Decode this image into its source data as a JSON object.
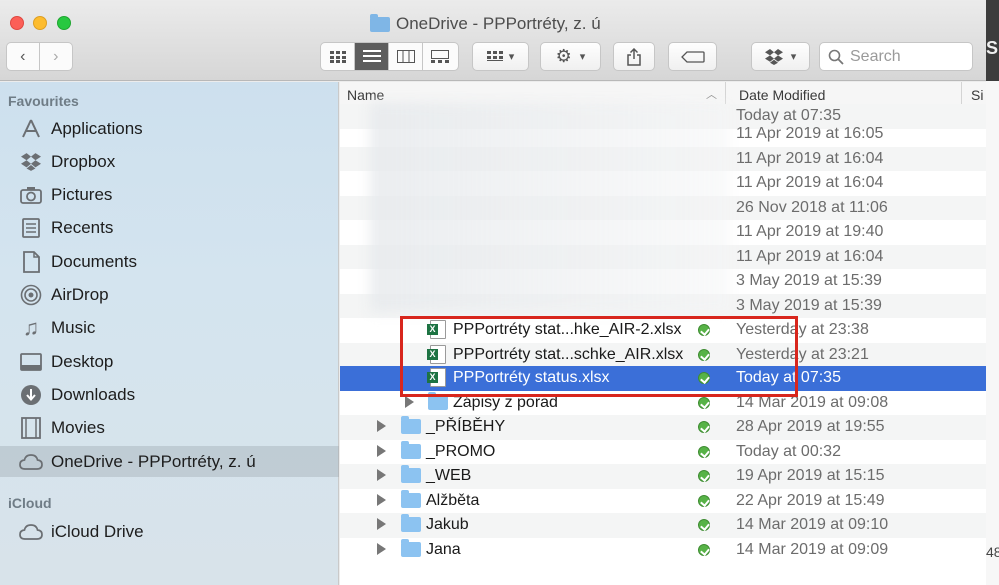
{
  "window": {
    "title": "OneDrive - PPPortréty, z. ú"
  },
  "toolbar": {
    "search_placeholder": "Search"
  },
  "sidebar": {
    "sections": [
      {
        "label": "Favourites",
        "items": [
          {
            "label": "Applications",
            "icon": "applications-icon"
          },
          {
            "label": "Dropbox",
            "icon": "dropbox-icon"
          },
          {
            "label": "Pictures",
            "icon": "camera-icon"
          },
          {
            "label": "Recents",
            "icon": "recents-icon"
          },
          {
            "label": "Documents",
            "icon": "document-icon"
          },
          {
            "label": "AirDrop",
            "icon": "airdrop-icon"
          },
          {
            "label": "Music",
            "icon": "music-note-icon"
          },
          {
            "label": "Desktop",
            "icon": "desktop-icon"
          },
          {
            "label": "Downloads",
            "icon": "download-icon"
          },
          {
            "label": "Movies",
            "icon": "film-icon"
          },
          {
            "label": "OneDrive - PPPortréty, z. ú",
            "icon": "cloud-icon",
            "selected": true
          }
        ]
      },
      {
        "label": "iCloud",
        "items": [
          {
            "label": "iCloud Drive",
            "icon": "cloud-icon"
          }
        ]
      }
    ]
  },
  "list": {
    "columns": {
      "name": "Name",
      "date": "Date Modified",
      "size": "Si"
    },
    "blurred_dates": [
      "Today at 07:35",
      "11 Apr 2019 at 16:05",
      "11 Apr 2019 at 16:04",
      "11 Apr 2019 at 16:04",
      "26 Nov 2018 at 11:06",
      "11 Apr 2019 at 19:40",
      "11 Apr 2019 at 16:04",
      "3 May 2019 at 15:39",
      "3 May 2019 at 15:39"
    ],
    "files": [
      {
        "name": "PPPortréty stat...hke_AIR-2.xlsx",
        "date": "Yesterday at 23:38",
        "kind": "xlsx"
      },
      {
        "name": "PPPortréty stat...schke_AIR.xlsx",
        "date": "Yesterday at 23:21",
        "kind": "xlsx"
      },
      {
        "name": "PPPortréty status.xlsx",
        "date": "Today at 07:35",
        "kind": "xlsx",
        "selected": true
      },
      {
        "name": "Zápisy z porad",
        "date": "14 Mar 2019 at 09:08",
        "kind": "folder",
        "level": 1
      },
      {
        "name": "_PŘÍBĚHY",
        "date": "28 Apr 2019 at 19:55",
        "kind": "folder"
      },
      {
        "name": "_PROMO",
        "date": "Today at 00:32",
        "kind": "folder"
      },
      {
        "name": "_WEB",
        "date": "19 Apr 2019 at 15:15",
        "kind": "folder"
      },
      {
        "name": "Alžběta",
        "date": "22 Apr 2019 at 15:49",
        "kind": "folder"
      },
      {
        "name": "Jakub",
        "date": "14 Mar 2019 at 09:10",
        "kind": "folder"
      },
      {
        "name": "Jana",
        "date": "14 Mar 2019 at 09:09",
        "kind": "folder"
      }
    ]
  },
  "edge": {
    "right_top_letter": "S",
    "right_bottom_text": "48"
  },
  "colors": {
    "selection": "#3b6fd8",
    "highlight_box": "#d8261d",
    "sync_ok": "#57b347"
  }
}
